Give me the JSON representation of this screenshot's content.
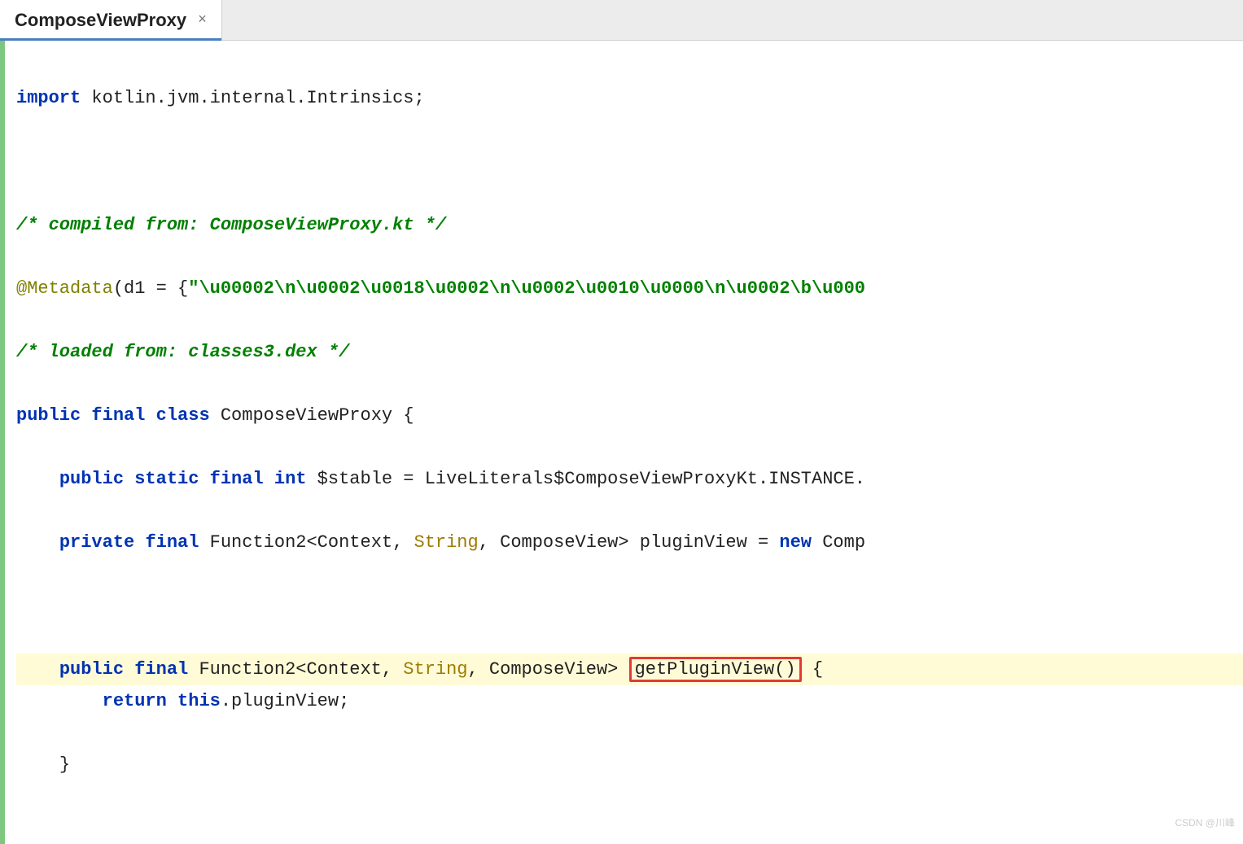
{
  "tab": {
    "title": "ComposeViewProxy"
  },
  "code": {
    "import_kw": "import",
    "import_path": " kotlin.jvm.internal.Intrinsics;",
    "comment1": "/* compiled from: ComposeViewProxy.kt */",
    "ann": "@Metadata",
    "ann_open": "(d1 = {",
    "str_literal": "\"\\u00002\\n\\u0002\\u0018\\u0002\\n\\u0002\\u0010\\u0000\\n\\u0002\\b\\u000",
    "comment2": "/* loaded from: classes3.dex */",
    "kw_public": "public",
    "kw_final": "final",
    "kw_class": "class",
    "kw_static": "static",
    "kw_int": "int",
    "kw_private": "private",
    "kw_new": "new",
    "kw_return": "return",
    "kw_this": "this",
    "class_name": " ComposeViewProxy ",
    "lbrace": "{",
    "rbrace": "}",
    "stable_field": " $stable = LiveLiterals$ComposeViewProxyKt.INSTANCE.",
    "func2": " Function2<Context, ",
    "string_type": "String",
    "cv_close": ", ComposeView> ",
    "plugin_field": "pluginView = ",
    "comp_suffix": " Comp",
    "getplugin": "getPluginView",
    "parens": "()",
    "space": " ",
    "return_expr": ".pluginView;"
  },
  "watermark": "CSDN @川峰"
}
